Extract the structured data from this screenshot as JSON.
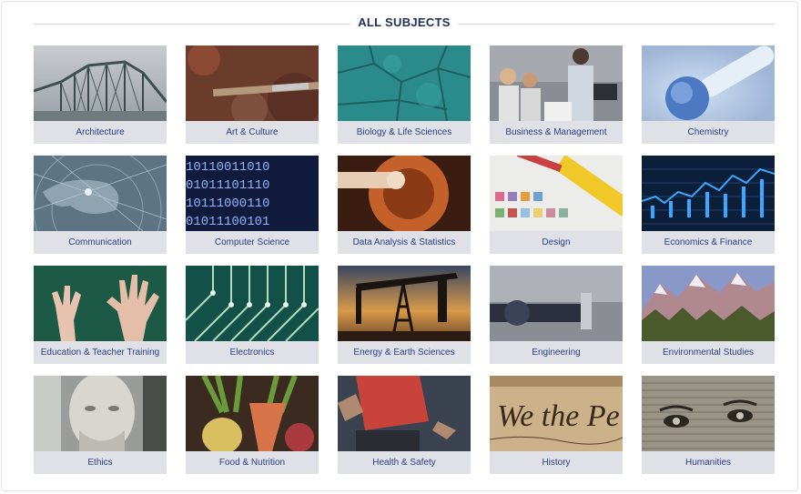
{
  "header": {
    "title": "ALL SUBJECTS"
  },
  "subjects": [
    {
      "label": "Architecture",
      "icon": "bridge-photo"
    },
    {
      "label": "Art & Culture",
      "icon": "paintbrush-photo"
    },
    {
      "label": "Biology & Life Sciences",
      "icon": "cells-photo"
    },
    {
      "label": "Business & Management",
      "icon": "meeting-photo"
    },
    {
      "label": "Chemistry",
      "icon": "lab-glass-photo"
    },
    {
      "label": "Communication",
      "icon": "globe-network-photo"
    },
    {
      "label": "Computer Science",
      "icon": "binary-code-photo"
    },
    {
      "label": "Data Analysis & Statistics",
      "icon": "abstract-sphere-photo"
    },
    {
      "label": "Design",
      "icon": "color-swatches-photo"
    },
    {
      "label": "Economics & Finance",
      "icon": "stock-chart-photo"
    },
    {
      "label": "Education & Teacher Training",
      "icon": "raised-hands-photo"
    },
    {
      "label": "Electronics",
      "icon": "circuit-board-photo"
    },
    {
      "label": "Energy & Earth Sciences",
      "icon": "oil-pump-photo"
    },
    {
      "label": "Engineering",
      "icon": "machine-part-photo"
    },
    {
      "label": "Environmental Studies",
      "icon": "mountains-photo"
    },
    {
      "label": "Ethics",
      "icon": "statue-bust-photo"
    },
    {
      "label": "Food & Nutrition",
      "icon": "vegetables-photo"
    },
    {
      "label": "Health & Safety",
      "icon": "runner-photo"
    },
    {
      "label": "History",
      "icon": "we-the-people-photo"
    },
    {
      "label": "Humanities",
      "icon": "portrait-engraving-photo"
    }
  ]
}
